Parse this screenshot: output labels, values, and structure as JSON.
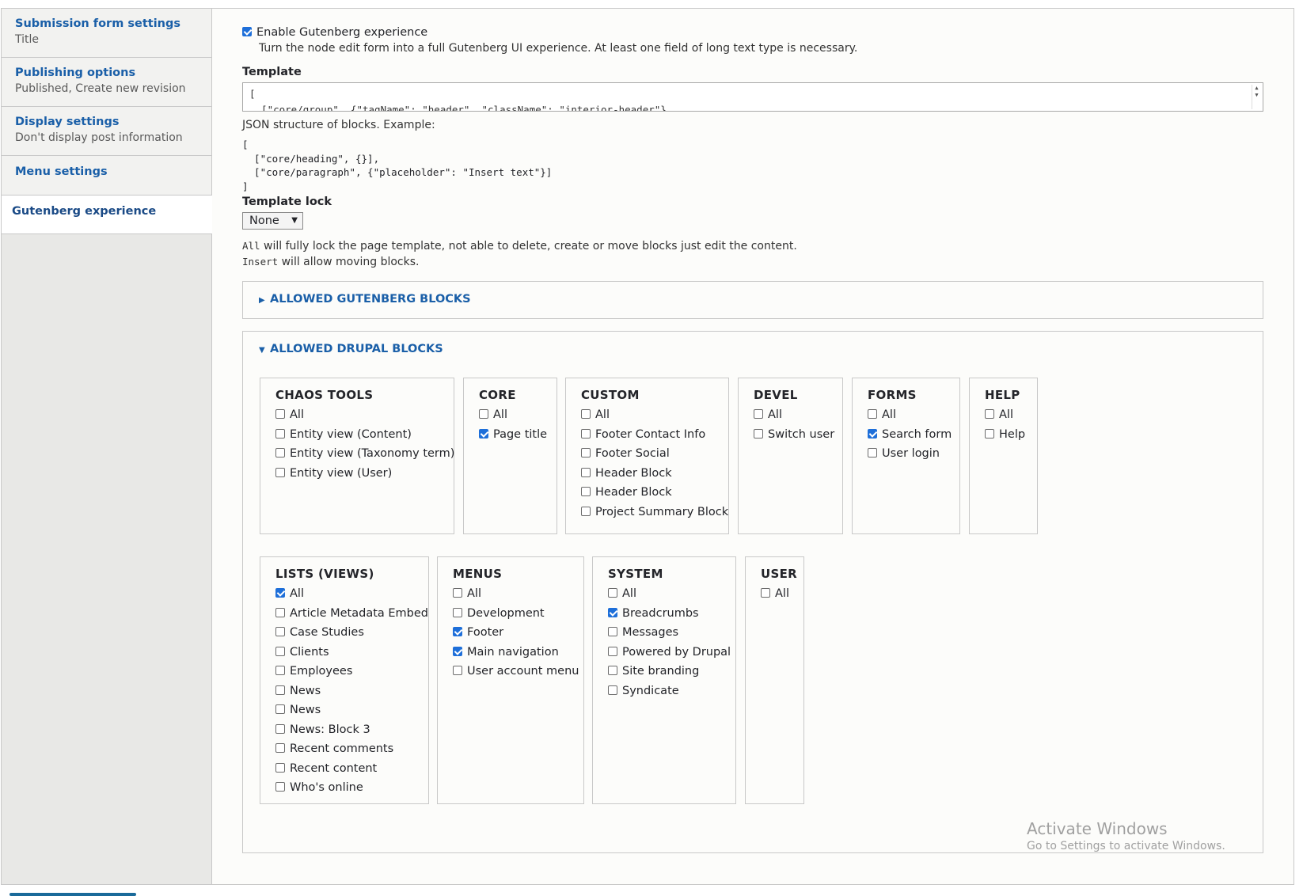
{
  "sidebar": {
    "tabs": [
      {
        "title": "Submission form settings",
        "summary": "Title"
      },
      {
        "title": "Publishing options",
        "summary": "Published, Create new revision"
      },
      {
        "title": "Display settings",
        "summary": "Don't display post information"
      },
      {
        "title": "Menu settings",
        "summary": ""
      },
      {
        "title": "Gutenberg experience",
        "summary": "",
        "active": true
      }
    ]
  },
  "gutenberg": {
    "enable_label": "Enable Gutenberg experience",
    "enable_checked": true,
    "enable_desc": "Turn the node edit form into a full Gutenberg UI experience. At least one field of long text type is necessary.",
    "template_label": "Template",
    "template_line1": "[",
    "template_line2": "  [\"core/group\", {\"tagName\": \"header\", \"className\": \"interior-header\"}",
    "template_desc": "JSON structure of blocks. Example:",
    "template_example": "[\n  [\"core/heading\", {}],\n  [\"core/paragraph\", {\"placeholder\": \"Insert text\"}]\n]",
    "lock_label": "Template lock",
    "lock_value": "None",
    "lock_desc1_code": "All",
    "lock_desc1_text": " will fully lock the page template, not able to delete, create or move blocks just edit the content.",
    "lock_desc2_code": "Insert",
    "lock_desc2_text": " will allow moving blocks."
  },
  "allowed_gutenberg": {
    "label": "Allowed Gutenberg blocks",
    "open": false
  },
  "allowed_drupal": {
    "label": "Allowed Drupal blocks",
    "open": true,
    "groups": [
      {
        "title": "CHAOS TOOLS",
        "items": [
          {
            "label": "All",
            "checked": false
          },
          {
            "label": "Entity view (Content)",
            "checked": false
          },
          {
            "label": "Entity view (Taxonomy term)",
            "checked": false
          },
          {
            "label": "Entity view (User)",
            "checked": false
          }
        ]
      },
      {
        "title": "CORE",
        "items": [
          {
            "label": "All",
            "checked": false
          },
          {
            "label": "Page title",
            "checked": true
          }
        ]
      },
      {
        "title": "CUSTOM",
        "items": [
          {
            "label": "All",
            "checked": false
          },
          {
            "label": "Footer Contact Info",
            "checked": false
          },
          {
            "label": "Footer Social",
            "checked": false
          },
          {
            "label": "Header Block",
            "checked": false
          },
          {
            "label": "Header Block",
            "checked": false
          },
          {
            "label": "Project Summary Block",
            "checked": false
          }
        ]
      },
      {
        "title": "DEVEL",
        "items": [
          {
            "label": "All",
            "checked": false
          },
          {
            "label": "Switch user",
            "checked": false
          }
        ]
      },
      {
        "title": "FORMS",
        "items": [
          {
            "label": "All",
            "checked": false
          },
          {
            "label": "Search form",
            "checked": true
          },
          {
            "label": "User login",
            "checked": false
          }
        ]
      },
      {
        "title": "HELP",
        "items": [
          {
            "label": "All",
            "checked": false
          },
          {
            "label": "Help",
            "checked": false
          }
        ]
      },
      {
        "title": "LISTS (VIEWS)",
        "items": [
          {
            "label": "All",
            "checked": true
          },
          {
            "label": "Article Metadata Embed",
            "checked": false
          },
          {
            "label": "Case Studies",
            "checked": false
          },
          {
            "label": "Clients",
            "checked": false
          },
          {
            "label": "Employees",
            "checked": false
          },
          {
            "label": "News",
            "checked": false
          },
          {
            "label": "News",
            "checked": false
          },
          {
            "label": "News: Block 3",
            "checked": false
          },
          {
            "label": "Recent comments",
            "checked": false
          },
          {
            "label": "Recent content",
            "checked": false
          },
          {
            "label": "Who's online",
            "checked": false
          }
        ]
      },
      {
        "title": "MENUS",
        "items": [
          {
            "label": "All",
            "checked": false
          },
          {
            "label": "Development",
            "checked": false
          },
          {
            "label": "Footer",
            "checked": true
          },
          {
            "label": "Main navigation",
            "checked": true
          },
          {
            "label": "User account menu",
            "checked": false
          }
        ]
      },
      {
        "title": "SYSTEM",
        "items": [
          {
            "label": "All",
            "checked": false
          },
          {
            "label": "Breadcrumbs",
            "checked": true
          },
          {
            "label": "Messages",
            "checked": false
          },
          {
            "label": "Powered by Drupal",
            "checked": false
          },
          {
            "label": "Site branding",
            "checked": false
          },
          {
            "label": "Syndicate",
            "checked": false
          }
        ]
      },
      {
        "title": "USER",
        "items": [
          {
            "label": "All",
            "checked": false
          }
        ]
      }
    ]
  },
  "watermark": {
    "title": "Activate Windows",
    "subtitle": "Go to Settings to activate Windows."
  },
  "colors": {
    "link": "#1a5fa8",
    "checkbox": "#1e6fd9"
  }
}
